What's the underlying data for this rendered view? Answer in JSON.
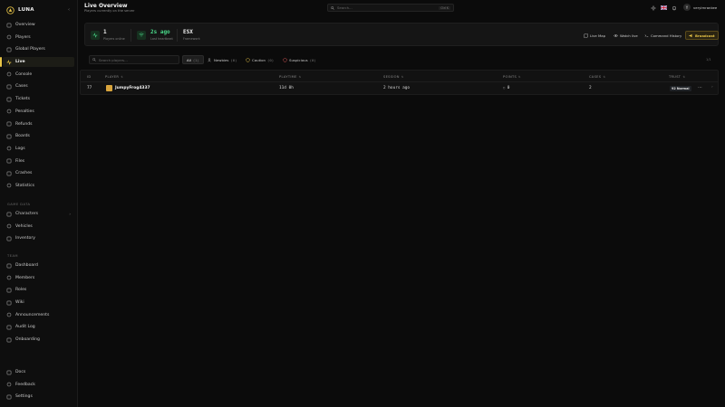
{
  "brand": {
    "name": "LUNA"
  },
  "sidebar": {
    "main_items": [
      {
        "label": "Overview",
        "icon": "home-icon"
      },
      {
        "label": "Players",
        "icon": "users-icon"
      },
      {
        "label": "Global Players",
        "icon": "globe-icon"
      },
      {
        "label": "Live",
        "icon": "activity-icon",
        "active": true
      },
      {
        "label": "Console",
        "icon": "terminal-icon"
      },
      {
        "label": "Cases",
        "icon": "briefcase-icon"
      },
      {
        "label": "Tickets",
        "icon": "ticket-icon"
      },
      {
        "label": "Penalties",
        "icon": "gavel-icon"
      },
      {
        "label": "Refunds",
        "icon": "refund-icon"
      },
      {
        "label": "Boards",
        "icon": "board-icon"
      },
      {
        "label": "Logs",
        "icon": "logs-icon"
      },
      {
        "label": "Files",
        "icon": "folder-icon"
      },
      {
        "label": "Crashes",
        "icon": "crash-icon"
      },
      {
        "label": "Statistics",
        "icon": "chart-icon"
      }
    ],
    "game_data_title": "GAME DATA",
    "game_data_items": [
      {
        "label": "Characters",
        "icon": "character-icon",
        "expandable": true
      },
      {
        "label": "Vehicles",
        "icon": "car-icon"
      },
      {
        "label": "Inventory",
        "icon": "box-icon"
      }
    ],
    "team_title": "TEAM",
    "team_items": [
      {
        "label": "Dashboard",
        "icon": "dashboard-icon"
      },
      {
        "label": "Members",
        "icon": "members-icon"
      },
      {
        "label": "Roles",
        "icon": "shield-icon"
      },
      {
        "label": "Wiki",
        "icon": "book-icon"
      },
      {
        "label": "Announcements",
        "icon": "megaphone-icon"
      },
      {
        "label": "Audit Log",
        "icon": "audit-icon"
      },
      {
        "label": "Onboarding",
        "icon": "onboarding-icon"
      }
    ],
    "bottom_items": [
      {
        "label": "Docs",
        "icon": "doc-icon"
      },
      {
        "label": "Feedback",
        "icon": "feedback-icon"
      },
      {
        "label": "Settings",
        "icon": "gear-icon"
      }
    ]
  },
  "header": {
    "title": "Live Overview",
    "subtitle": "Players currently on the server",
    "search_placeholder": "Search...",
    "search_shortcut": "Ctrl K",
    "user_initial": "Y",
    "user_name": "verylmrankee"
  },
  "stats": {
    "players_value": "1",
    "players_label": "Players online",
    "updated_value": "2s ago",
    "updated_label": "Last heartbeat",
    "framework_value": "ESX",
    "framework_label": "Framework",
    "accent_color": "#4ad98a"
  },
  "actions": {
    "live_map": "Live Map",
    "watch_live": "Watch live",
    "command_history": "Command History",
    "broadcast": "Broadcast"
  },
  "filters": {
    "search_placeholder": "Search players...",
    "tabs": [
      {
        "label": "All",
        "count": "(1)",
        "active": true
      },
      {
        "label": "Newbies",
        "count": "(0)"
      },
      {
        "label": "Caution",
        "count": "(0)"
      },
      {
        "label": "Suspicious",
        "count": "(0)"
      }
    ],
    "pagination": "1/1"
  },
  "table": {
    "columns": [
      "ID",
      "PLAYER",
      "PLAYTIME",
      "SESSION",
      "POINTS",
      "CASES",
      "TRUST"
    ],
    "rows": [
      {
        "id": "77",
        "player": "JumpyFrog4337",
        "playtime": "11d 0h",
        "session": "2 hours ago",
        "points": "0",
        "cases": "2",
        "trust": "Normal",
        "trust_score": "92"
      }
    ]
  }
}
